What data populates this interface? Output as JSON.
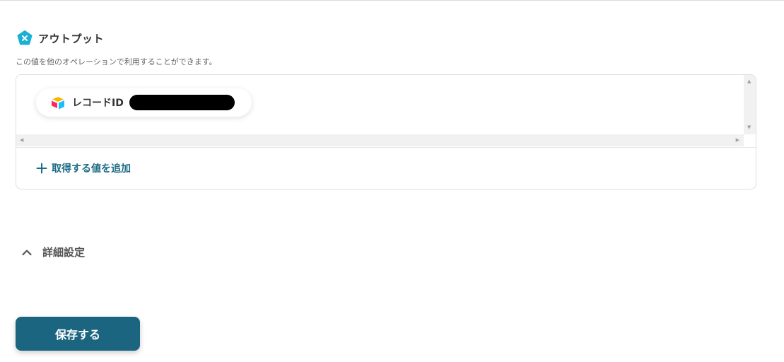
{
  "output_section": {
    "title": "アウトプット",
    "description": "この値を他のオペレーションで利用することができます。",
    "icon": "output-x-icon"
  },
  "output_items": [
    {
      "label": "レコードID",
      "icon": "airtable-icon",
      "value_redacted": true
    }
  ],
  "add_value": {
    "label": "取得する値を追加",
    "icon": "plus-icon"
  },
  "advanced_settings": {
    "label": "詳細設定",
    "icon": "chevron-up-icon",
    "expanded": true
  },
  "save_button": {
    "label": "保存する"
  },
  "colors": {
    "accent": "#1b6b84",
    "button": "#1b6580",
    "icon_cyan": "#1ab0d6"
  }
}
